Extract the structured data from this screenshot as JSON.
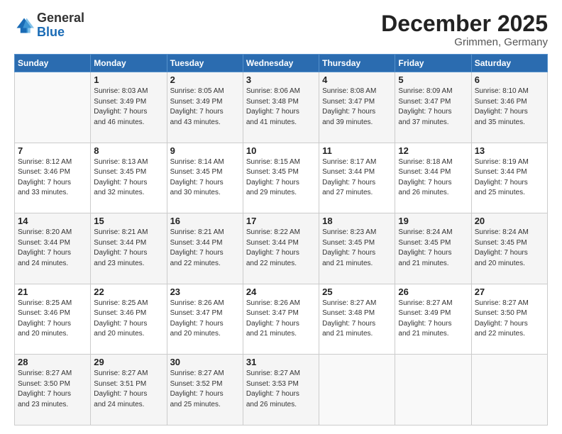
{
  "logo": {
    "general": "General",
    "blue": "Blue"
  },
  "header": {
    "month_title": "December 2025",
    "subtitle": "Grimmen, Germany"
  },
  "weekdays": [
    "Sunday",
    "Monday",
    "Tuesday",
    "Wednesday",
    "Thursday",
    "Friday",
    "Saturday"
  ],
  "weeks": [
    [
      {
        "day": "",
        "info": ""
      },
      {
        "day": "1",
        "info": "Sunrise: 8:03 AM\nSunset: 3:49 PM\nDaylight: 7 hours\nand 46 minutes."
      },
      {
        "day": "2",
        "info": "Sunrise: 8:05 AM\nSunset: 3:49 PM\nDaylight: 7 hours\nand 43 minutes."
      },
      {
        "day": "3",
        "info": "Sunrise: 8:06 AM\nSunset: 3:48 PM\nDaylight: 7 hours\nand 41 minutes."
      },
      {
        "day": "4",
        "info": "Sunrise: 8:08 AM\nSunset: 3:47 PM\nDaylight: 7 hours\nand 39 minutes."
      },
      {
        "day": "5",
        "info": "Sunrise: 8:09 AM\nSunset: 3:47 PM\nDaylight: 7 hours\nand 37 minutes."
      },
      {
        "day": "6",
        "info": "Sunrise: 8:10 AM\nSunset: 3:46 PM\nDaylight: 7 hours\nand 35 minutes."
      }
    ],
    [
      {
        "day": "7",
        "info": "Sunrise: 8:12 AM\nSunset: 3:46 PM\nDaylight: 7 hours\nand 33 minutes."
      },
      {
        "day": "8",
        "info": "Sunrise: 8:13 AM\nSunset: 3:45 PM\nDaylight: 7 hours\nand 32 minutes."
      },
      {
        "day": "9",
        "info": "Sunrise: 8:14 AM\nSunset: 3:45 PM\nDaylight: 7 hours\nand 30 minutes."
      },
      {
        "day": "10",
        "info": "Sunrise: 8:15 AM\nSunset: 3:45 PM\nDaylight: 7 hours\nand 29 minutes."
      },
      {
        "day": "11",
        "info": "Sunrise: 8:17 AM\nSunset: 3:44 PM\nDaylight: 7 hours\nand 27 minutes."
      },
      {
        "day": "12",
        "info": "Sunrise: 8:18 AM\nSunset: 3:44 PM\nDaylight: 7 hours\nand 26 minutes."
      },
      {
        "day": "13",
        "info": "Sunrise: 8:19 AM\nSunset: 3:44 PM\nDaylight: 7 hours\nand 25 minutes."
      }
    ],
    [
      {
        "day": "14",
        "info": "Sunrise: 8:20 AM\nSunset: 3:44 PM\nDaylight: 7 hours\nand 24 minutes."
      },
      {
        "day": "15",
        "info": "Sunrise: 8:21 AM\nSunset: 3:44 PM\nDaylight: 7 hours\nand 23 minutes."
      },
      {
        "day": "16",
        "info": "Sunrise: 8:21 AM\nSunset: 3:44 PM\nDaylight: 7 hours\nand 22 minutes."
      },
      {
        "day": "17",
        "info": "Sunrise: 8:22 AM\nSunset: 3:44 PM\nDaylight: 7 hours\nand 22 minutes."
      },
      {
        "day": "18",
        "info": "Sunrise: 8:23 AM\nSunset: 3:45 PM\nDaylight: 7 hours\nand 21 minutes."
      },
      {
        "day": "19",
        "info": "Sunrise: 8:24 AM\nSunset: 3:45 PM\nDaylight: 7 hours\nand 21 minutes."
      },
      {
        "day": "20",
        "info": "Sunrise: 8:24 AM\nSunset: 3:45 PM\nDaylight: 7 hours\nand 20 minutes."
      }
    ],
    [
      {
        "day": "21",
        "info": "Sunrise: 8:25 AM\nSunset: 3:46 PM\nDaylight: 7 hours\nand 20 minutes."
      },
      {
        "day": "22",
        "info": "Sunrise: 8:25 AM\nSunset: 3:46 PM\nDaylight: 7 hours\nand 20 minutes."
      },
      {
        "day": "23",
        "info": "Sunrise: 8:26 AM\nSunset: 3:47 PM\nDaylight: 7 hours\nand 20 minutes."
      },
      {
        "day": "24",
        "info": "Sunrise: 8:26 AM\nSunset: 3:47 PM\nDaylight: 7 hours\nand 21 minutes."
      },
      {
        "day": "25",
        "info": "Sunrise: 8:27 AM\nSunset: 3:48 PM\nDaylight: 7 hours\nand 21 minutes."
      },
      {
        "day": "26",
        "info": "Sunrise: 8:27 AM\nSunset: 3:49 PM\nDaylight: 7 hours\nand 21 minutes."
      },
      {
        "day": "27",
        "info": "Sunrise: 8:27 AM\nSunset: 3:50 PM\nDaylight: 7 hours\nand 22 minutes."
      }
    ],
    [
      {
        "day": "28",
        "info": "Sunrise: 8:27 AM\nSunset: 3:50 PM\nDaylight: 7 hours\nand 23 minutes."
      },
      {
        "day": "29",
        "info": "Sunrise: 8:27 AM\nSunset: 3:51 PM\nDaylight: 7 hours\nand 24 minutes."
      },
      {
        "day": "30",
        "info": "Sunrise: 8:27 AM\nSunset: 3:52 PM\nDaylight: 7 hours\nand 25 minutes."
      },
      {
        "day": "31",
        "info": "Sunrise: 8:27 AM\nSunset: 3:53 PM\nDaylight: 7 hours\nand 26 minutes."
      },
      {
        "day": "",
        "info": ""
      },
      {
        "day": "",
        "info": ""
      },
      {
        "day": "",
        "info": ""
      }
    ]
  ]
}
